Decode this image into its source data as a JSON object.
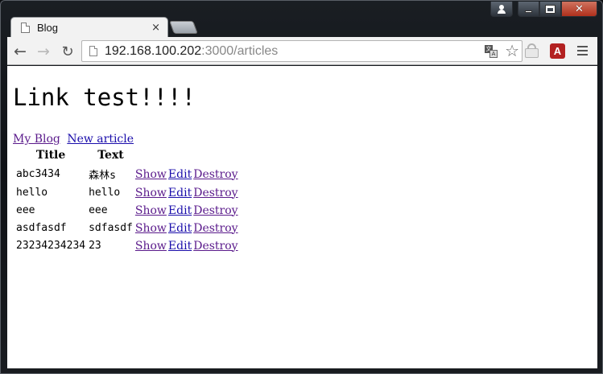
{
  "browser": {
    "tab": {
      "title": "Blog",
      "close_glyph": "×"
    },
    "toolbar": {
      "back_glyph": "←",
      "forward_glyph": "→",
      "reload_glyph": "↻",
      "url_host": "192.168.100.202",
      "url_path": ":3000/articles",
      "star_glyph": "☆",
      "ext_label": "A"
    },
    "caption": {
      "close_glyph": "✕"
    },
    "icons": [
      "user-icon",
      "minimize-icon",
      "maximize-icon",
      "close-icon",
      "page-icon",
      "translate-icon",
      "star-icon",
      "lock-extension-icon",
      "acrobat-extension-icon",
      "menu-icon"
    ]
  },
  "page": {
    "title": "Link test!!!!",
    "nav": [
      {
        "label": "My Blog"
      },
      {
        "label": "New article"
      }
    ],
    "table": {
      "headers": [
        "Title",
        "Text"
      ],
      "rows": [
        {
          "title": "abc3434",
          "text": "森林s",
          "show": "Show",
          "edit": "Edit",
          "destroy": "Destroy"
        },
        {
          "title": "hello",
          "text": "hello",
          "show": "Show",
          "edit": "Edit",
          "destroy": "Destroy"
        },
        {
          "title": "eee",
          "text": "eee",
          "show": "Show",
          "edit": "Edit",
          "destroy": "Destroy"
        },
        {
          "title": "asdfasdf",
          "text": "sdfasdf",
          "show": "Show",
          "edit": "Edit",
          "destroy": "Destroy"
        },
        {
          "title": "23234234234",
          "text": "23",
          "show": "Show",
          "edit": "Edit",
          "destroy": "Destroy"
        }
      ]
    }
  },
  "colors": {
    "link_visited": "#5a1a8b",
    "link_unvisited": "#1a0dab",
    "close_button": "#c7412b"
  }
}
